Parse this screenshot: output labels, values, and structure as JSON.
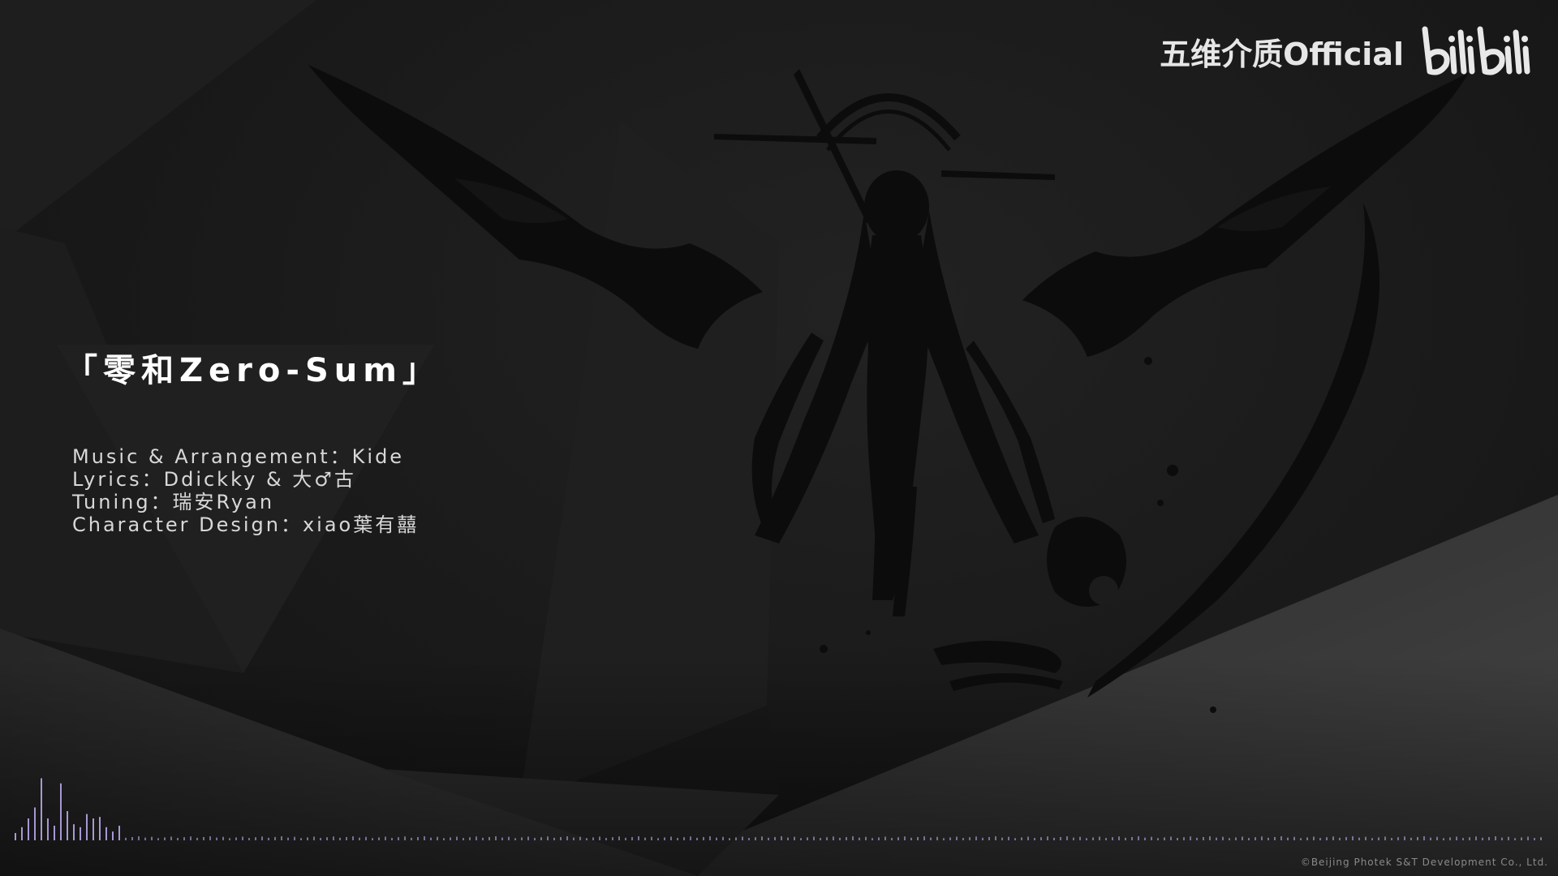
{
  "watermark": {
    "channel_name": "五维介质Official",
    "platform_logo_icon": "bilibili-logo-icon",
    "platform_logo_text": "bilibili"
  },
  "song": {
    "title": "「零和Zero-Sum」"
  },
  "credits": [
    "Music & Arrangement：Kide",
    "Lyrics：Ddickky & 大♂古",
    "Tuning：瑞安Ryan",
    "Character Design：xiao葉有囍"
  ],
  "copyright": "©Beijing Photek S&T Development Co., Ltd.",
  "colors": {
    "background": "#1b1b1b",
    "silhouette": "#0c0c0c",
    "visualizer_accent": "#b8a6e8",
    "text_primary": "#ffffff",
    "text_secondary": "#d8d8d8"
  },
  "visualizer": {
    "levels": [
      0.1,
      0.18,
      0.3,
      0.45,
      0.85,
      0.3,
      0.2,
      0.78,
      0.4,
      0.22,
      0.18,
      0.36,
      0.3,
      0.32,
      0.18,
      0.12,
      0.2
    ]
  }
}
